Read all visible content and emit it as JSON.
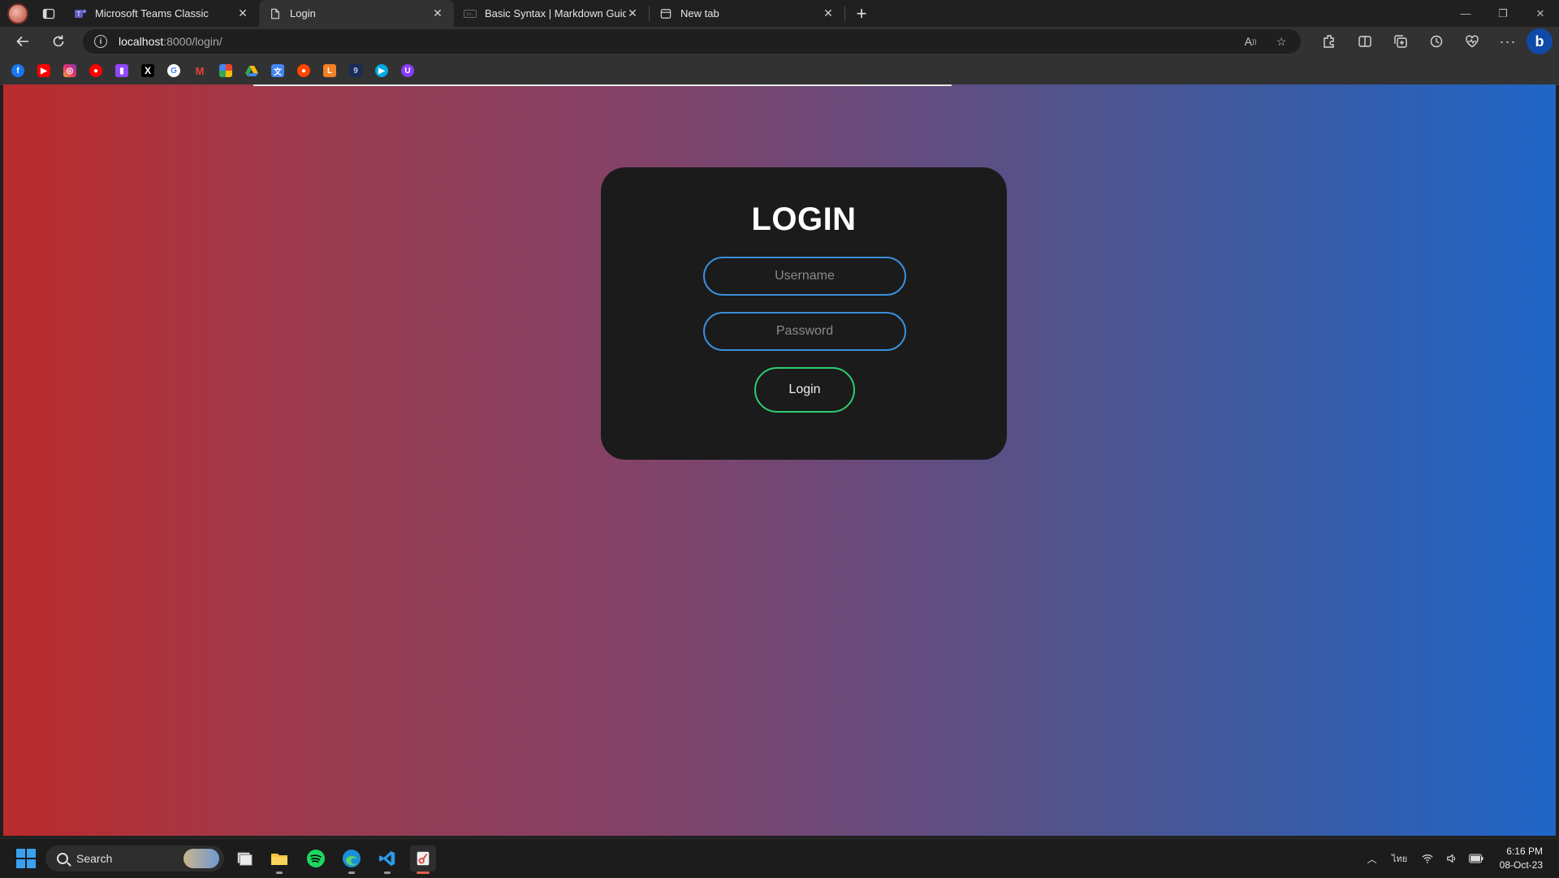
{
  "browser": {
    "tabs": [
      {
        "title": "Microsoft Teams Classic",
        "icon": "teams-icon",
        "active": false
      },
      {
        "title": "Login",
        "icon": "page-icon",
        "active": true
      },
      {
        "title": "Basic Syntax | Markdown Guide",
        "icon": "markdown-icon",
        "active": false
      },
      {
        "title": "New tab",
        "icon": "newtab-icon",
        "active": false
      }
    ],
    "url_host": "localhost",
    "url_rest": ":8000/login/",
    "favorites": [
      "facebook-icon",
      "youtube-icon",
      "instagram-icon",
      "youtube-music-icon",
      "twitch-icon",
      "x-icon",
      "google-icon",
      "gmail-icon",
      "pinwheel-icon",
      "google-drive-icon",
      "google-translate-icon",
      "reddit-icon",
      "leetcode-icon",
      "9anime-icon",
      "prime-video-icon",
      "ublock-icon"
    ]
  },
  "page": {
    "title": "LOGIN",
    "username_placeholder": "Username",
    "password_placeholder": "Password",
    "login_label": "Login",
    "colors": {
      "gradient_left": "#bb2b2c",
      "gradient_right": "#1f66c8",
      "card_bg": "#1b1b1b",
      "input_border": "#3a8fd8",
      "button_border": "#2ecc71"
    }
  },
  "taskbar": {
    "search_label": "Search",
    "language": "ไทย",
    "time": "6:16 PM",
    "date": "08-Oct-23"
  }
}
